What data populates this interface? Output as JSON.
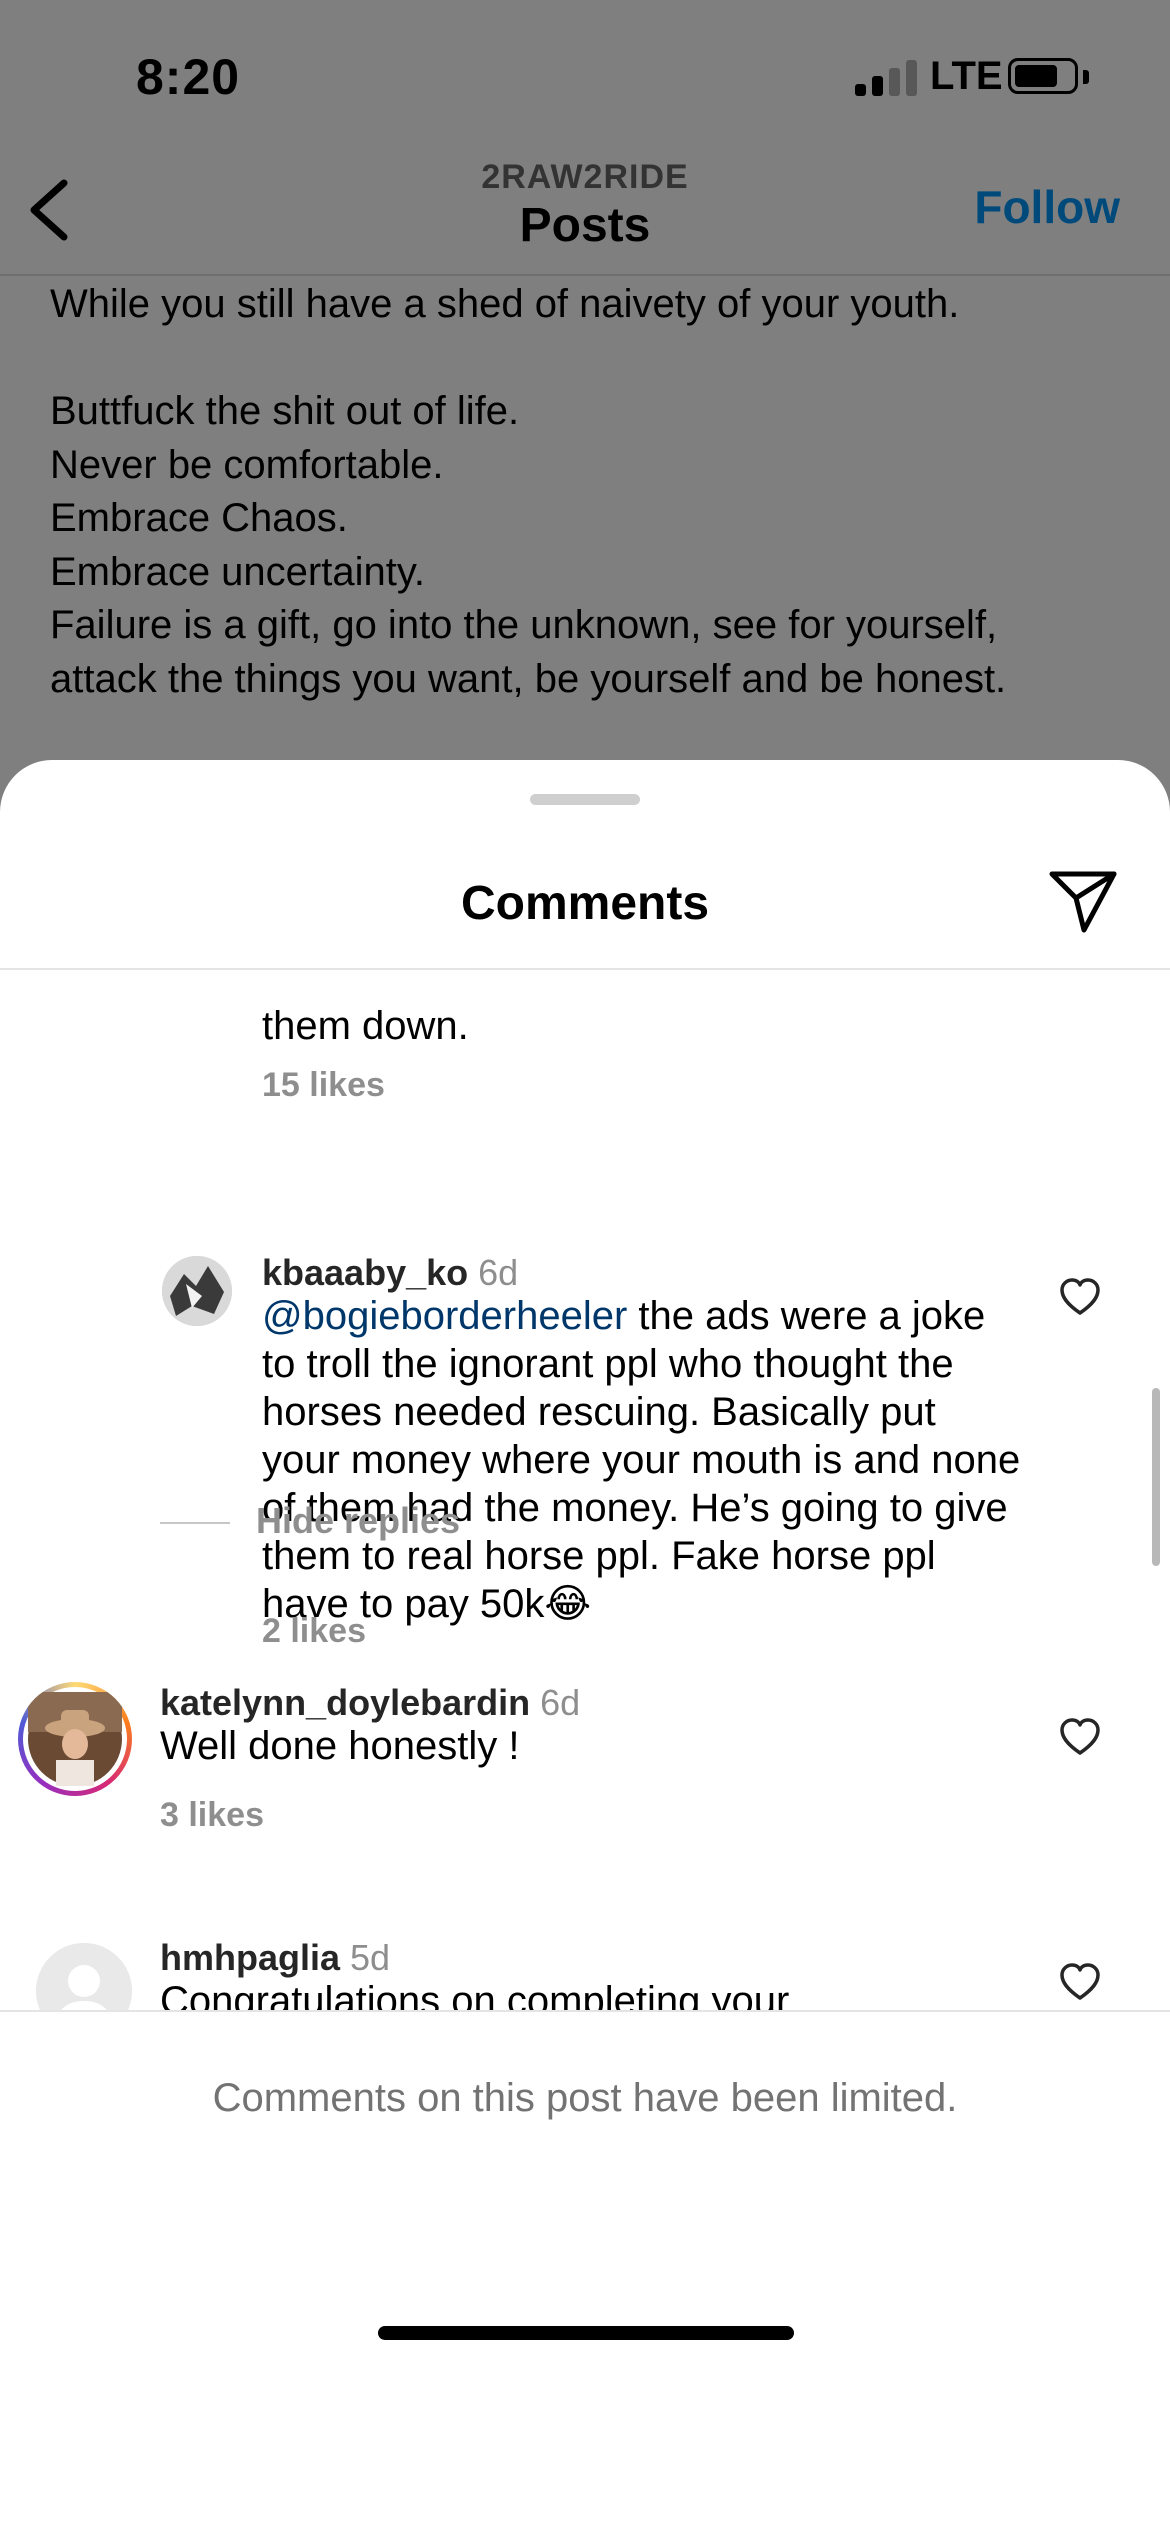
{
  "status_bar": {
    "time": "8:20",
    "carrier": "LTE"
  },
  "header": {
    "account": "2RAW2RIDE",
    "title": "Posts",
    "follow_label": "Follow"
  },
  "post": {
    "lines": [
      "While you still have a shed of naivety of your youth.",
      "",
      "Buttfuck the shit out of life.",
      "Never be comfortable.",
      "Embrace Chaos.",
      "Embrace uncertainty.",
      "Failure is a gift, go into the unknown, see for yourself,",
      "attack the things you want, be yourself and be honest."
    ]
  },
  "comments_sheet": {
    "title": "Comments",
    "clipped_comment": {
      "tail": "them down.",
      "likes": "15 likes"
    },
    "comments": [
      {
        "username": "kbaaaby_ko",
        "time": "6d",
        "mention": "@bogieborderheeler",
        "text": " the ads were a joke to troll the ignorant ppl who thought the horses needed rescuing. Basically put your money where your mouth is and none of them had the money. He’s going to give them to real horse ppl. Fake horse ppl have to pay 50k😂",
        "likes": "2 likes"
      },
      {
        "username": "katelynn_doylebardin",
        "time": "6d",
        "text": "Well done honestly !",
        "likes": "3 likes"
      },
      {
        "username": "hmhpaglia",
        "time": "5d",
        "text": "Congratulations on completing your adventure. I hope you make sure those"
      }
    ],
    "hide_replies": "Hide replies",
    "limited_notice": "Comments on this post have been limited."
  },
  "colors": {
    "follow": "#0095f6",
    "mention": "#00376b",
    "muted": "#8e8e8e",
    "story_ring": [
      "#feda75",
      "#fa7e1e",
      "#d62976",
      "#962fbf"
    ]
  },
  "icons": [
    "back-arrow-icon",
    "send-icon",
    "heart-icon",
    "signal-icon",
    "battery-icon"
  ]
}
